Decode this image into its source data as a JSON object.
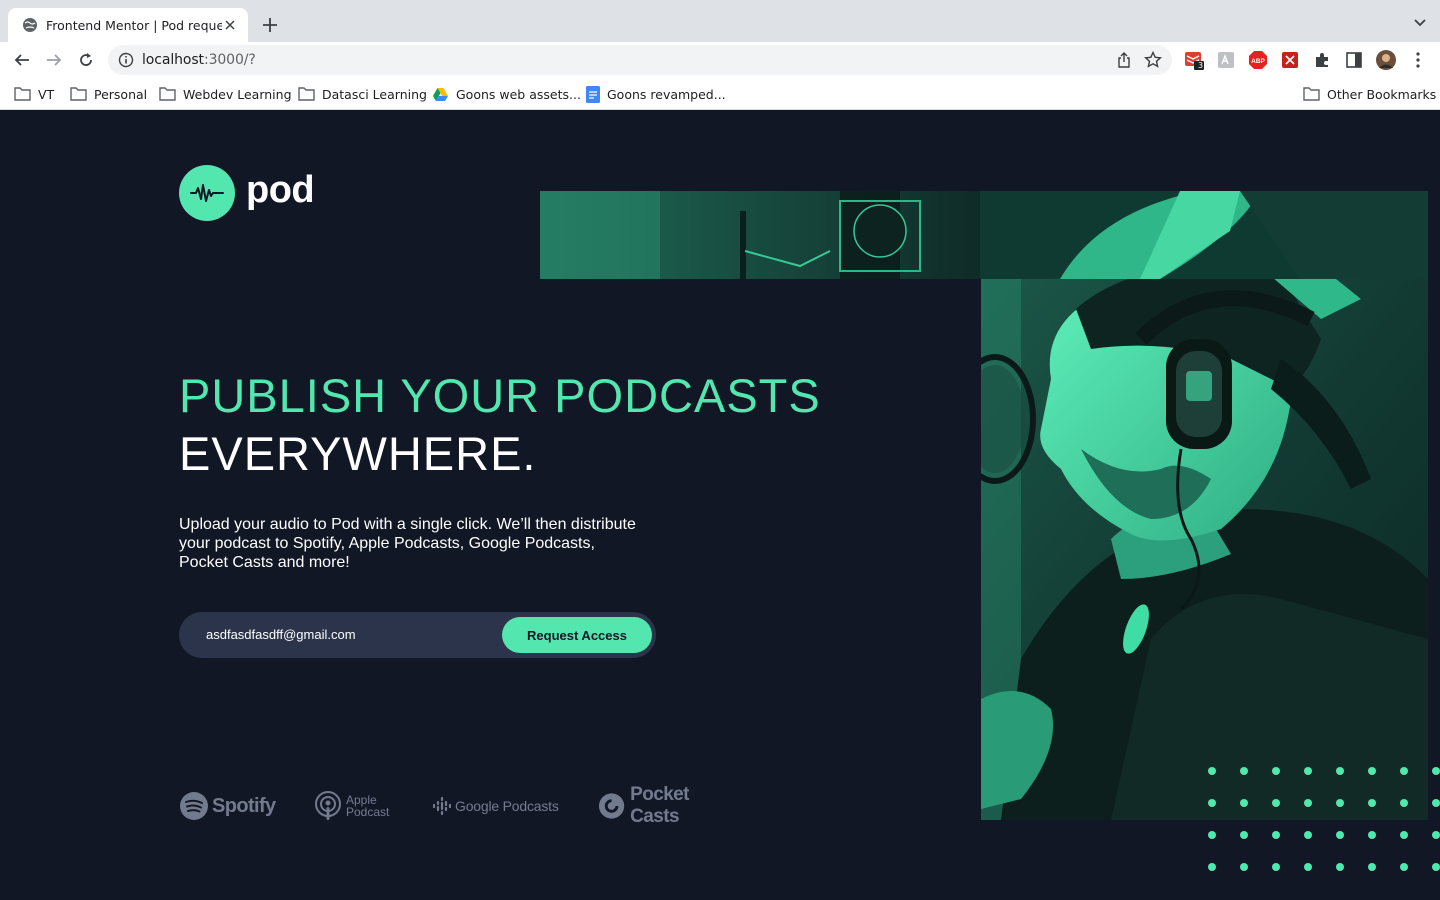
{
  "browser": {
    "tab_title": "Frontend Mentor | Pod request",
    "url_host": "localhost",
    "url_rest": ":3000/?",
    "extension_badge": "3",
    "bookmarks": [
      {
        "label": "VT",
        "icon": "folder-icon"
      },
      {
        "label": "Personal",
        "icon": "folder-icon"
      },
      {
        "label": "Webdev Learning",
        "icon": "folder-icon"
      },
      {
        "label": "Datasci Learning",
        "icon": "folder-icon"
      },
      {
        "label": "Goons web assets...",
        "icon": "google-drive-icon"
      },
      {
        "label": "Goons revamped...",
        "icon": "google-docs-icon"
      },
      {
        "label": "Other Bookmarks",
        "icon": "folder-icon"
      }
    ]
  },
  "page": {
    "logo_text": "pod",
    "headline_line1": "PUBLISH YOUR PODCASTS",
    "headline_line2": "EVERYWHERE.",
    "description": "Upload your audio to Pod with a single click. We’ll then distribute your podcast to Spotify, Apple Podcasts, Google Podcasts, Pocket Casts and more!",
    "email_value": "asdfasdfasdff@gmail.com",
    "request_button": "Request Access",
    "platforms": {
      "spotify": "Spotify",
      "apple_line1": "Apple",
      "apple_line2": "Podcast",
      "google": "Google Podcasts",
      "pocket": "Pocket Casts"
    }
  },
  "colors": {
    "background": "#121725",
    "accent": "#54e6af",
    "input_bg": "#2c344b"
  }
}
